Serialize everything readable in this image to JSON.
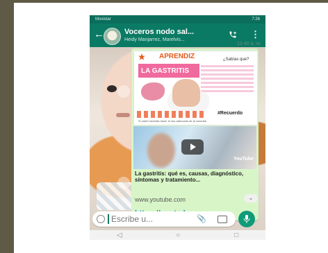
{
  "status": {
    "carrier": "Movistar",
    "time": "7:26"
  },
  "chat": {
    "title": "Voceros nodo sal...",
    "subtitle": "Heidy Manjarrez, Marelvis...",
    "time_label": "12:40 a. m."
  },
  "message": {
    "poster_heading": "APRENDIZ",
    "poster_question": "¿Sabías que?",
    "poster_topic": "LA GASTRITIS",
    "poster_remember": "#Recuerdo",
    "poster_footer": "Si usted necesita hacer el uso adecuado de la consulta",
    "video_brand": "YouTube",
    "link_title": "La gastritis: qué es, causas, diagnóstico, síntomas y tratamiento...",
    "link_domain": "www.youtube.com",
    "link_url": "https://youtu.be"
  },
  "composer": {
    "placeholder": "Escribe u..."
  },
  "icons": {
    "back": "back-arrow-icon",
    "call": "add-call-icon",
    "menu": "more-vert-icon",
    "emoji": "emoji-icon",
    "attach": "paperclip-icon",
    "camera": "camera-icon",
    "mic": "microphone-icon",
    "play": "play-icon"
  },
  "colors": {
    "header": "#0b7a64",
    "bubble": "#d8f5c7",
    "link": "#1f85d6",
    "mic": "#109a78"
  }
}
